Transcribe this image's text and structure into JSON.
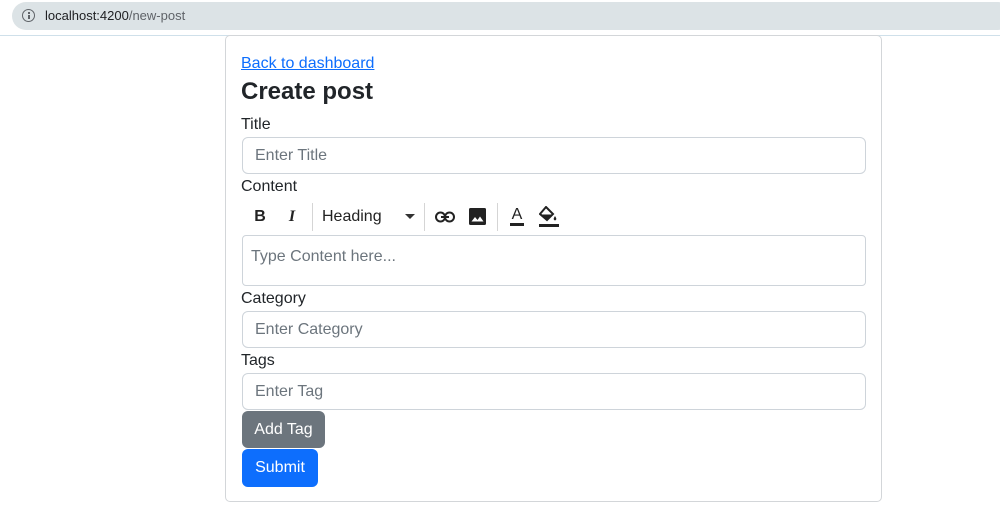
{
  "browser": {
    "url_host": "localhost:4200",
    "url_path": "/new-post"
  },
  "page": {
    "back_link": "Back to dashboard",
    "title": "Create post"
  },
  "form": {
    "title_label": "Title",
    "title_placeholder": "Enter Title",
    "content_label": "Content",
    "content_placeholder": "Type Content here...",
    "category_label": "Category",
    "category_placeholder": "Enter Category",
    "tags_label": "Tags",
    "tag_placeholder": "Enter Tag",
    "add_tag_label": "Add Tag",
    "submit_label": "Submit"
  },
  "toolbar": {
    "bold_glyph": "B",
    "italic_glyph": "I",
    "heading_label": "Heading",
    "font_color_glyph": "A",
    "icons": [
      "bold-icon",
      "italic-icon",
      "chevron-down-icon",
      "link-icon",
      "image-icon",
      "font-color-icon",
      "fill-color-icon"
    ]
  },
  "colors": {
    "primary": "#0d6efd",
    "secondary": "#6c757d",
    "link": "#0d6efd"
  }
}
